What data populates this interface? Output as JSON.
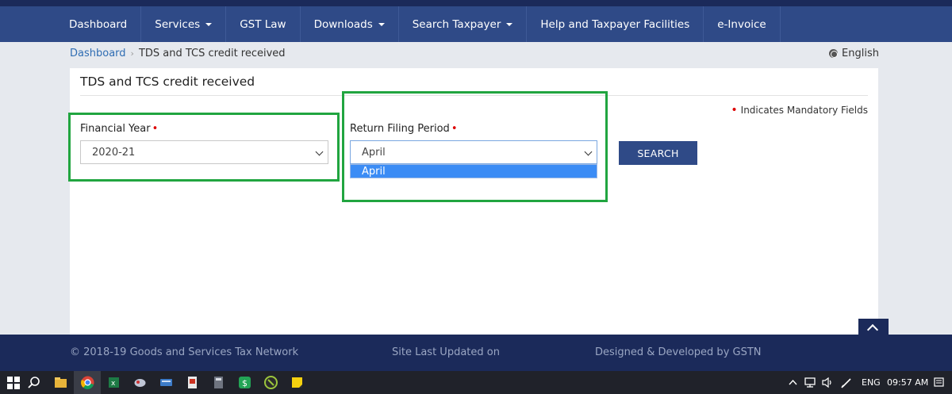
{
  "nav": {
    "items": [
      {
        "label": "Dashboard",
        "dropdown": false
      },
      {
        "label": "Services",
        "dropdown": true
      },
      {
        "label": "GST Law",
        "dropdown": false
      },
      {
        "label": "Downloads",
        "dropdown": true
      },
      {
        "label": "Search Taxpayer",
        "dropdown": true
      },
      {
        "label": "Help and Taxpayer Facilities",
        "dropdown": false
      },
      {
        "label": "e-Invoice",
        "dropdown": false
      }
    ]
  },
  "breadcrumb": {
    "link": "Dashboard",
    "separator": "›",
    "current": "TDS and TCS credit received"
  },
  "language": {
    "label": "English",
    "icon": "globe-icon"
  },
  "panel": {
    "title": "TDS and TCS credit received",
    "mandatory_note": "Indicates Mandatory Fields",
    "required_marker": "•"
  },
  "form": {
    "financial_year": {
      "label": "Financial Year",
      "value": "2020-21"
    },
    "return_period": {
      "label": "Return Filing Period",
      "value": "April",
      "options": [
        "April"
      ]
    },
    "search_label": "SEARCH"
  },
  "footer": {
    "copyright": "© 2018-19 Goods and Services Tax Network",
    "updated": "Site Last Updated on",
    "designed": "Designed & Developed by GSTN"
  },
  "taskbar": {
    "language": "ENG",
    "time": "09:57 AM"
  },
  "colors": {
    "nav_bg": "#2f4a87",
    "footer_bg": "#1b2a5a",
    "highlight": "#21a540",
    "dropdown_selected": "#3b8cf5",
    "required": "#dd0000"
  }
}
